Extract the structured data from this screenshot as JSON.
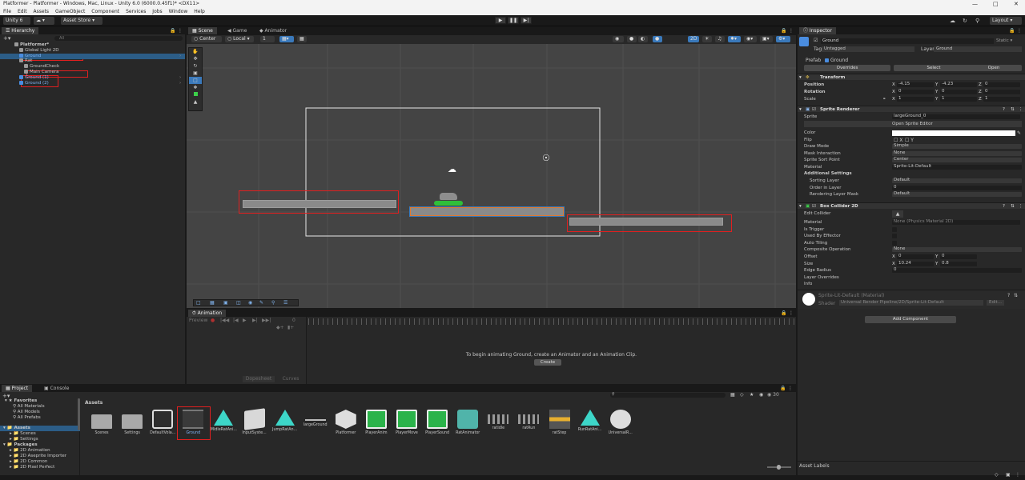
{
  "window": {
    "title": "Platformer - Platformer - Windows, Mac, Linux - Unity 6.0 (6000.0.45f1)* <DX11>"
  },
  "menu": [
    "File",
    "Edit",
    "Assets",
    "GameObject",
    "Component",
    "Services",
    "Jobs",
    "Window",
    "Help"
  ],
  "toolbar": {
    "account": "Unity 6",
    "asset_store": "Asset Store",
    "layout": "Layout"
  },
  "hierarchy": {
    "tab": "Hierarchy",
    "search_placeholder": "All",
    "items": [
      {
        "label": "Platformer*",
        "indent": 0,
        "icon": "unity-scene-icon",
        "bold": true
      },
      {
        "label": "Global Light 2D",
        "indent": 1,
        "icon": "gameobject-icon"
      },
      {
        "label": "Ground",
        "indent": 1,
        "icon": "prefab-cube-icon",
        "blue": true,
        "selected": true,
        "highlight": true
      },
      {
        "label": "Rat",
        "indent": 1,
        "icon": "gameobject-icon"
      },
      {
        "label": "GroundCheck",
        "indent": 2,
        "icon": "gameobject-icon"
      },
      {
        "label": "Main Camera",
        "indent": 2,
        "icon": "camera-icon",
        "highlight": true
      },
      {
        "label": "Ground (1)",
        "indent": 1,
        "icon": "prefab-cube-icon",
        "blue": true,
        "highlight": true
      },
      {
        "label": "Ground (2)",
        "indent": 1,
        "icon": "prefab-cube-icon",
        "blue": true,
        "highlight": true
      }
    ]
  },
  "scene_tabs": {
    "scene": "Scene",
    "game": "Game",
    "animator": "Animator"
  },
  "scene_toolbar": {
    "pivot": "Center",
    "space": "Local",
    "grid_value": "1",
    "mode_2d": "2D"
  },
  "animation": {
    "tab": "Animation",
    "preview": "Preview",
    "frame": "0",
    "message": "To begin animating Ground, create an Animator and an Animation Clip.",
    "create": "Create",
    "dopesheet": "Dopesheet",
    "curves": "Curves"
  },
  "project": {
    "tab_project": "Project",
    "tab_console": "Console",
    "favorites": "Favorites",
    "fav_items": [
      "All Materials",
      "All Models",
      "All Prefabs"
    ],
    "assets_root": "Assets",
    "asset_folders": [
      "Scenes",
      "Settings"
    ],
    "packages": "Packages",
    "package_items": [
      "2D Animation",
      "2D Aseprite Importer",
      "2D Common",
      "2D Pixel Perfect"
    ],
    "breadcrumb": "Assets",
    "hidden_count": "30",
    "grid_items": [
      {
        "label": "Scenes",
        "kind": "folder"
      },
      {
        "label": "Settings",
        "kind": "folder"
      },
      {
        "label": "DefaultVola...",
        "kind": "volume"
      },
      {
        "label": "Ground",
        "kind": "prefab",
        "highlight": true
      },
      {
        "label": "MidleRatAni...",
        "kind": "anim"
      },
      {
        "label": "InputSyste...",
        "kind": "input"
      },
      {
        "label": "JumpRatAn...",
        "kind": "anim"
      },
      {
        "label": "largeGround",
        "kind": "sprite"
      },
      {
        "label": "Platformer",
        "kind": "unity"
      },
      {
        "label": "PlayerAnim",
        "kind": "script"
      },
      {
        "label": "PlayerMove",
        "kind": "script"
      },
      {
        "label": "PlayerSound",
        "kind": "script"
      },
      {
        "label": "RatAnimator",
        "kind": "animator"
      },
      {
        "label": "ratidle",
        "kind": "spritesheet"
      },
      {
        "label": "ratRun",
        "kind": "spritesheet"
      },
      {
        "label": "ratStep",
        "kind": "audio"
      },
      {
        "label": "RunRatAni...",
        "kind": "anim"
      },
      {
        "label": "UniversalR...",
        "kind": "urp"
      }
    ]
  },
  "inspector": {
    "tab": "Inspector",
    "object_name": "Ground",
    "static": "Static",
    "tag_label": "Tag",
    "tag": "Untagged",
    "layer_label": "Layer",
    "layer": "Ground",
    "prefab_label": "Prefab",
    "prefab": "Ground",
    "overrides": "Overrides",
    "select": "Select",
    "open": "Open",
    "transform": {
      "title": "Transform",
      "position_label": "Position",
      "position": {
        "x": "-4.15",
        "y": "-4.23",
        "z": "0"
      },
      "rotation_label": "Rotation",
      "rotation": {
        "x": "0",
        "y": "0",
        "z": "0"
      },
      "scale_label": "Scale",
      "scale": {
        "x": "1",
        "y": "1",
        "z": "1"
      }
    },
    "sprite_renderer": {
      "title": "Sprite Renderer",
      "sprite_label": "Sprite",
      "sprite": "largeGround_0",
      "open_editor": "Open Sprite Editor",
      "color_label": "Color",
      "flip_label": "Flip",
      "flip_x": "X",
      "flip_y": "Y",
      "draw_mode_label": "Draw Mode",
      "draw_mode": "Simple",
      "mask_label": "Mask Interaction",
      "mask": "None",
      "sort_point_label": "Sprite Sort Point",
      "sort_point": "Center",
      "material_label": "Material",
      "material": "Sprite-Lit-Default",
      "additional": "Additional Settings",
      "sorting_layer_label": "Sorting Layer",
      "sorting_layer": "Default",
      "order_label": "Order in Layer",
      "order": "0",
      "rendering_mask_label": "Rendering Layer Mask",
      "rendering_mask": "Default"
    },
    "box_collider": {
      "title": "Box Collider 2D",
      "edit_label": "Edit Collider",
      "material_label": "Material",
      "material": "None (Physics Material 2D)",
      "trigger_label": "Is Trigger",
      "effector_label": "Used By Effector",
      "tiling_label": "Auto Tiling",
      "composite_label": "Composite Operation",
      "composite": "None",
      "offset_label": "Offset",
      "offset": {
        "x": "0",
        "y": "0"
      },
      "size_label": "Size",
      "size": {
        "x": "10.24",
        "y": "0.8"
      },
      "edge_label": "Edge Radius",
      "edge": "0",
      "layer_overrides": "Layer Overrides",
      "info": "Info"
    },
    "material_preview": {
      "name": "Sprite-Lit-Default (Material)",
      "shader_label": "Shader",
      "shader": "Universal Render Pipeline/2D/Sprite-Lit-Default",
      "edit": "Edit..."
    },
    "add_component": "Add Component",
    "asset_labels": "Asset Labels"
  },
  "colors": {
    "selection": "#2c5d87",
    "highlight": "#e02020",
    "accent": "#3a79bb"
  }
}
